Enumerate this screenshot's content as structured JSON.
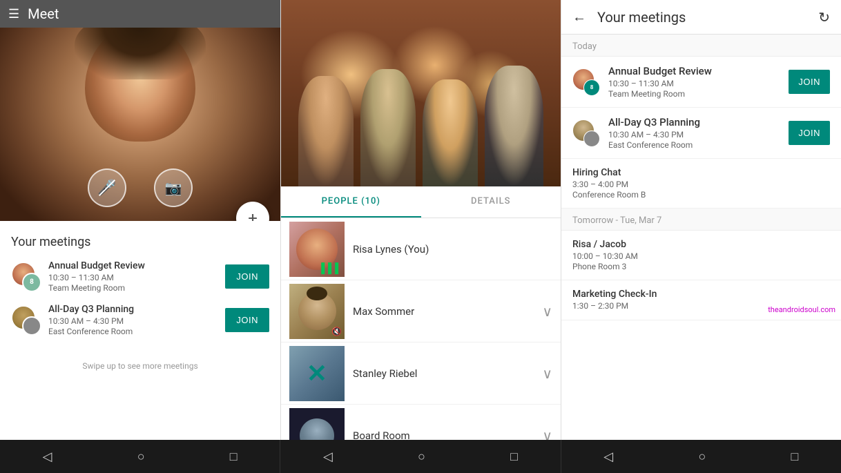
{
  "app": {
    "title": "Meet"
  },
  "left_panel": {
    "meetings_title": "Your meetings",
    "swipe_hint": "Swipe up to see more meetings",
    "meetings": [
      {
        "name": "Annual Budget Review",
        "time": "10:30 – 11:30 AM",
        "room": "Team Meeting Room",
        "join_label": "JOIN",
        "avatar_count": "8"
      },
      {
        "name": "All-Day Q3 Planning",
        "time": "10:30 AM – 4:30 PM",
        "room": "East Conference Room",
        "join_label": "JOIN",
        "avatar_count": ""
      }
    ]
  },
  "middle_panel": {
    "tabs": [
      {
        "label": "PEOPLE (10)",
        "active": true
      },
      {
        "label": "DETAILS",
        "active": false
      }
    ],
    "people": [
      {
        "name": "Risa Lynes (You)",
        "has_expand": false
      },
      {
        "name": "Max Sommer",
        "has_expand": true
      },
      {
        "name": "Stanley Riebel",
        "has_expand": true
      },
      {
        "name": "Board Room",
        "has_expand": true
      }
    ]
  },
  "right_panel": {
    "title": "Your meetings",
    "sections": [
      {
        "day_label": "Today",
        "meetings": [
          {
            "name": "Annual Budget Review",
            "time": "10:30 – 11:30 AM",
            "room": "Team Meeting Room",
            "join_label": "JOIN",
            "has_join": true
          },
          {
            "name": "All-Day Q3 Planning",
            "time": "10:30 AM – 4:30 PM",
            "room": "East Conference Room",
            "join_label": "JOIN",
            "has_join": true
          },
          {
            "name": "Hiring Chat",
            "time": "3:30 – 4:00 PM",
            "room": "Conference Room B",
            "has_join": false
          }
        ]
      },
      {
        "day_label": "Tomorrow - Tue, Mar 7",
        "meetings": [
          {
            "name": "Risa / Jacob",
            "time": "10:00 – 10:30 AM",
            "room": "Phone Room 3",
            "has_join": false
          },
          {
            "name": "Marketing Check-In",
            "time": "1:30 – 2:30 PM",
            "room": "",
            "has_join": false
          }
        ]
      }
    ],
    "watermark": "theandroidsoul.com"
  },
  "icons": {
    "hamburger": "☰",
    "back": "←",
    "refresh": "↻",
    "plus": "+",
    "mute": "🔇",
    "video_off": "🚫",
    "expand": "∨",
    "back_nav": "◁",
    "home_nav": "○",
    "square_nav": "□",
    "bars": "▌▌▌"
  }
}
